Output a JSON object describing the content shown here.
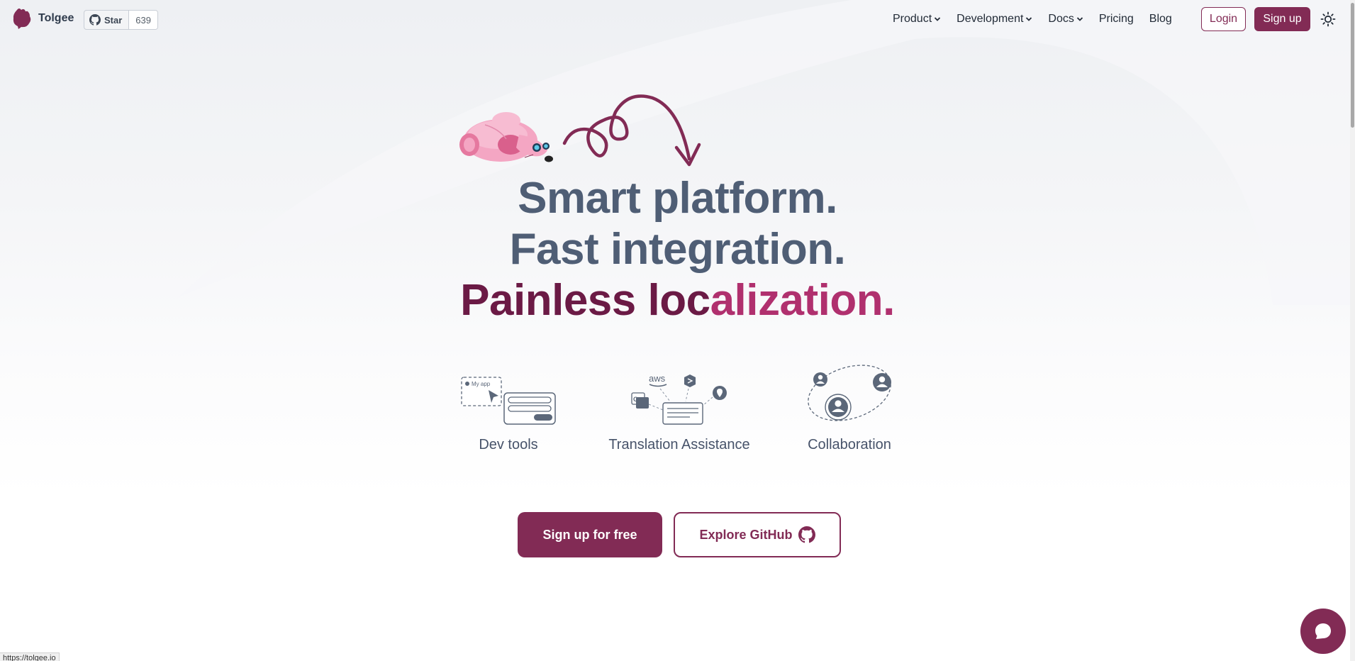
{
  "header": {
    "brand_name": "Tolgee",
    "github_star": {
      "label": "Star",
      "count": "639"
    },
    "nav": [
      {
        "label": "Product",
        "has_dropdown": true
      },
      {
        "label": "Development",
        "has_dropdown": true
      },
      {
        "label": "Docs",
        "has_dropdown": true
      },
      {
        "label": "Pricing",
        "has_dropdown": false
      },
      {
        "label": "Blog",
        "has_dropdown": false
      }
    ],
    "login_label": "Login",
    "signup_label": "Sign up",
    "theme_icon": "sun-icon"
  },
  "hero": {
    "line1": "Smart platform.",
    "line2": "Fast integration.",
    "line3_part1": "Painless loc",
    "line3_part2": "alization."
  },
  "features": [
    {
      "label": "Dev tools",
      "icon": "dev-tools-illustration",
      "mini_text": "My app"
    },
    {
      "label": "Translation Assistance",
      "icon": "translation-assistance-illustration",
      "mini_text": "aws"
    },
    {
      "label": "Collaboration",
      "icon": "collaboration-illustration"
    }
  ],
  "cta": {
    "primary_label": "Sign up for free",
    "secondary_label": "Explore GitHub"
  },
  "status_bar": {
    "url": "https://tolgee.io"
  },
  "colors": {
    "brand": "#822b55",
    "headline": "#4f5e75",
    "headline_dark": "#6b1a45",
    "headline_accent": "#b0306e"
  }
}
